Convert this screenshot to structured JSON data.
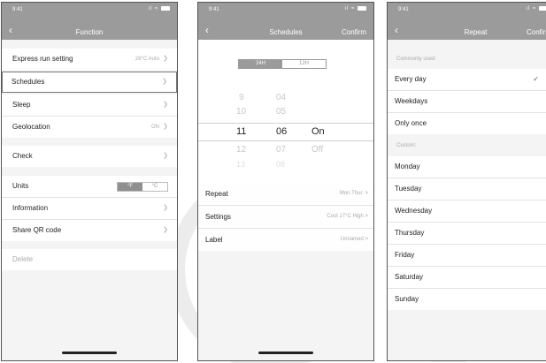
{
  "status": {
    "time": "9:41",
    "signal": "..ıl",
    "wifi": "ᯤ"
  },
  "screen1": {
    "title": "Function",
    "rows": [
      {
        "label": "Express run setting",
        "value": "28°C Auto"
      },
      {
        "label": "Schedules",
        "value": ""
      },
      {
        "label": "Sleep",
        "value": ""
      },
      {
        "label": "Geolocation",
        "value": "ON"
      },
      {
        "label": "Check",
        "value": ""
      },
      {
        "label": "Units",
        "value": ""
      },
      {
        "label": "Information",
        "value": ""
      },
      {
        "label": "Share QR code",
        "value": ""
      },
      {
        "label": "Delete",
        "value": ""
      }
    ],
    "units_toggle": {
      "left": "°F",
      "right": "°C"
    }
  },
  "screen2": {
    "title": "Schedules",
    "confirm": "Confirm",
    "format": {
      "left": "24H",
      "right": "12H"
    },
    "picker": {
      "hours": [
        "9",
        "10",
        "11",
        "12",
        "13"
      ],
      "minutes": [
        "04",
        "05",
        "06",
        "07",
        "08"
      ],
      "states": [
        "On",
        "Off"
      ]
    },
    "rows": [
      {
        "label": "Repeat",
        "value": "Mon.Thur. >"
      },
      {
        "label": "Settings",
        "value": "Cool 17°C High >"
      },
      {
        "label": "Label",
        "value": "Unnamed >"
      }
    ]
  },
  "screen3": {
    "title": "Repeat",
    "confirm": "Confirm",
    "common_label": "Commonly used:",
    "common": [
      "Every day",
      "Weekdays",
      "Only once"
    ],
    "custom_label": "Custom:",
    "custom": [
      "Monday",
      "Tuesday",
      "Wednesday",
      "Thursday",
      "Friday",
      "Saturday",
      "Sunday"
    ]
  }
}
